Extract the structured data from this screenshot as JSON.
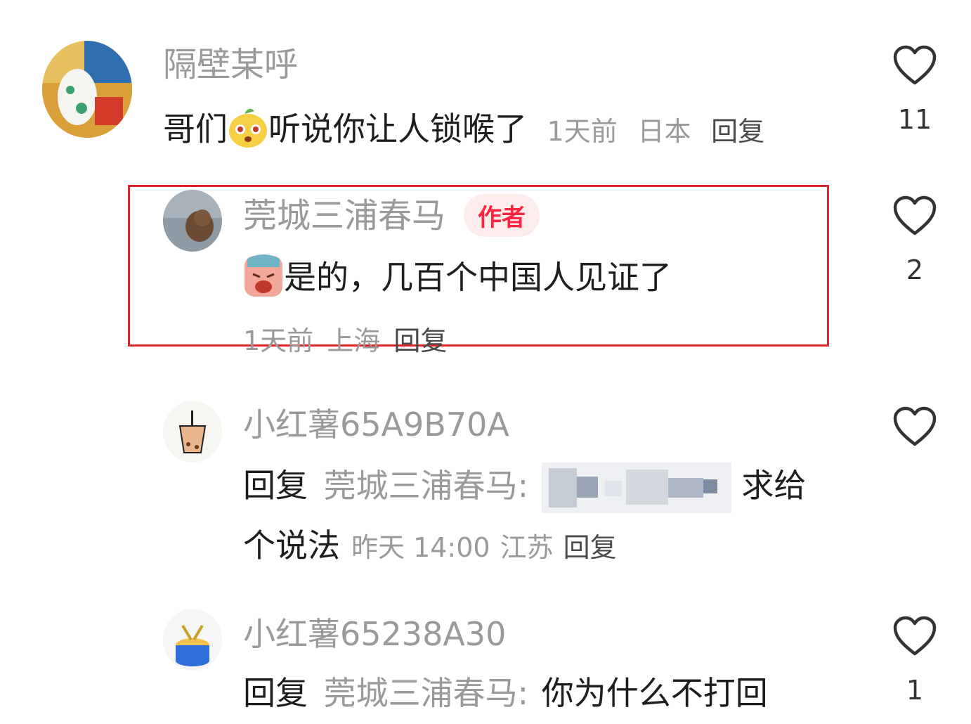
{
  "comments": [
    {
      "user": "隔壁某呼",
      "text_before_emoji": "哥们",
      "text_after_emoji": "听说你让人锁喉了",
      "time": "1天前",
      "location": "日本",
      "reply_label": "回复",
      "likes": "11"
    }
  ],
  "author_reply": {
    "user": "莞城三浦春马",
    "tag": "作者",
    "text": "是的，几百个中国人见证了",
    "time": "1天前",
    "location": "上海",
    "reply_label": "回复",
    "likes": "2"
  },
  "sub_replies": [
    {
      "user": "小红薯65A9B70A",
      "reply_prefix": "回复",
      "reply_to": "莞城三浦春马:",
      "text_tail": "求给",
      "text_line2": "个说法",
      "time": "昨天 14:00",
      "location": "江苏",
      "reply_label": "回复"
    },
    {
      "user": "小红薯65238A30",
      "reply_prefix": "回复",
      "reply_to": "莞城三浦春马:",
      "text": "你为什么不打回",
      "likes": "1"
    }
  ],
  "colors": {
    "accent": "#ff2442",
    "highlight_border": "#e0242b",
    "muted_text": "#9a9a9a"
  },
  "icons": {
    "like": "heart-outline-icon",
    "emoji_1": "surprised-face-emoji",
    "emoji_2": "crying-face-emoji"
  }
}
